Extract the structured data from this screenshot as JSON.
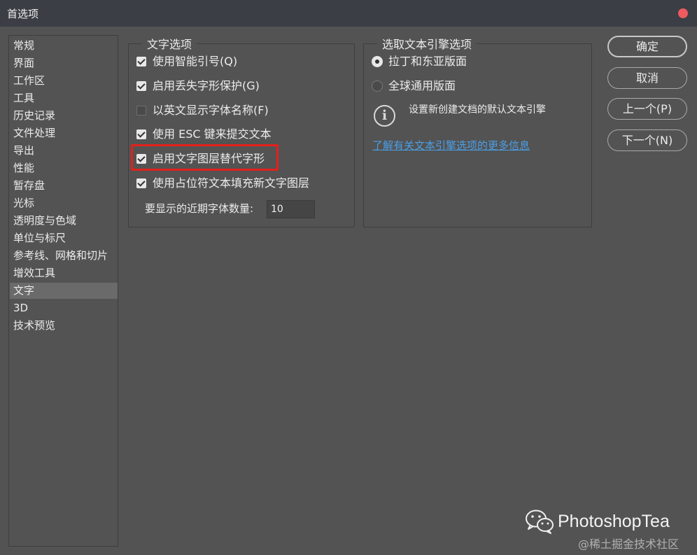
{
  "window": {
    "title": "首选项"
  },
  "sidebar": {
    "items": [
      {
        "label": "常规"
      },
      {
        "label": "界面"
      },
      {
        "label": "工作区"
      },
      {
        "label": "工具"
      },
      {
        "label": "历史记录"
      },
      {
        "label": "文件处理"
      },
      {
        "label": "导出"
      },
      {
        "label": "性能"
      },
      {
        "label": "暂存盘"
      },
      {
        "label": "光标"
      },
      {
        "label": "透明度与色域"
      },
      {
        "label": "单位与标尺"
      },
      {
        "label": "参考线、网格和切片"
      },
      {
        "label": "增效工具"
      },
      {
        "label": "文字"
      },
      {
        "label": "3D"
      },
      {
        "label": "技术预览"
      }
    ],
    "selected_label": "文字"
  },
  "text_options": {
    "legend": "文字选项",
    "options": [
      {
        "label": "使用智能引号(Q)",
        "checked": true
      },
      {
        "label": "启用丢失字形保护(G)",
        "checked": true
      },
      {
        "label": "以英文显示字体名称(F)",
        "checked": false
      },
      {
        "label": "使用 ESC 键来提交文本",
        "checked": true
      },
      {
        "label": "启用文字图层替代字形",
        "checked": true
      },
      {
        "label": "使用占位符文本填充新文字图层",
        "checked": true
      }
    ],
    "recent_fonts_label": "要显示的近期字体数量:",
    "recent_fonts_value": "10"
  },
  "engine_options": {
    "legend": "选取文本引擎选项",
    "radios": [
      {
        "label": "拉丁和东亚版面",
        "selected": true
      },
      {
        "label": "全球通用版面",
        "selected": false
      }
    ],
    "info_text": "设置新创建文档的默认文本引擎",
    "learn_more": "了解有关文本引擎选项的更多信息"
  },
  "buttons": {
    "ok": "确定",
    "cancel": "取消",
    "prev": "上一个(P)",
    "next": "下一个(N)"
  },
  "watermark": {
    "title": "PhotoshopTea",
    "subtitle": "@稀土掘金技术社区"
  },
  "colors": {
    "window_bg": "#535353",
    "titlebar_bg": "#3b3e44",
    "close_dot": "#ee5a5e",
    "highlight_border": "#e3201c",
    "link": "#4a9fe8",
    "selected_item_bg": "#6a6a6a"
  }
}
